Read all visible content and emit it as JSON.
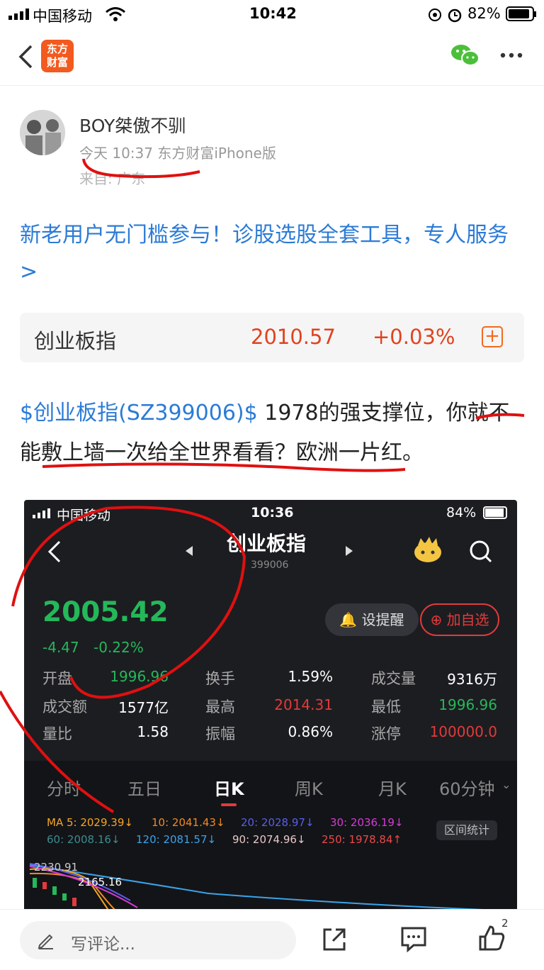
{
  "status_bar": {
    "carrier": "中国移动",
    "time": "10:42",
    "battery": "82%"
  },
  "nav": {
    "logo_top": "东方",
    "logo_bottom": "财富"
  },
  "author": {
    "name": "BOY桀傲不驯",
    "meta": "今天 10:37 东方财富iPhone版",
    "from": "来自: 广东"
  },
  "promo": "新老用户无门槛参与！诊股选股全套工具，专人服务>",
  "quote": {
    "name": "创业板指",
    "price": "2010.57",
    "change": "+0.03%",
    "add_icon": "+"
  },
  "post": {
    "tag": "$创业板指(SZ399006)$",
    "text": " 1978的强支撑位，你就不能敷上墙一次给全世界看看？欧洲一片红。"
  },
  "screenshot": {
    "status": {
      "carrier": "中国移动",
      "time": "10:36",
      "battery": "84%"
    },
    "title": "创业板指",
    "code": "399006",
    "price": "2005.42",
    "change": "-4.47",
    "change_pct": "-0.22%",
    "remind": "设提醒",
    "add": "加自选",
    "stats": [
      {
        "label": "开盘",
        "value": "1996.96",
        "color": "green"
      },
      {
        "label": "换手",
        "value": "1.59%",
        "color": "white"
      },
      {
        "label": "成交量",
        "value": "9316万",
        "color": "white"
      },
      {
        "label": "成交额",
        "value": "1577亿",
        "color": "white"
      },
      {
        "label": "最高",
        "value": "2014.31",
        "color": "red"
      },
      {
        "label": "最低",
        "value": "1996.96",
        "color": "green"
      },
      {
        "label": "量比",
        "value": "1.58",
        "color": "white"
      },
      {
        "label": "振幅",
        "value": "0.86%",
        "color": "white"
      },
      {
        "label": "涨停",
        "value": "100000.0",
        "color": "red"
      }
    ],
    "tabs": [
      "分时",
      "五日",
      "日K",
      "周K",
      "月K",
      "60分钟"
    ],
    "active_tab": "日K",
    "ma": [
      {
        "text": "MA 5: 2029.39↓",
        "color": "#f5a623"
      },
      {
        "text": "10: 2041.43↓",
        "color": "#f08a24"
      },
      {
        "text": "20: 2028.97↓",
        "color": "#5a5ee8"
      },
      {
        "text": "30: 2036.19↓",
        "color": "#d63bd6"
      },
      {
        "text": "60: 2008.16↓",
        "color": "#3a8d8d"
      },
      {
        "text": "120: 2081.57↓",
        "color": "#3aa3e8"
      },
      {
        "text": "90: 2074.96↓",
        "color": "#e8c7c7"
      },
      {
        "text": "250: 1978.84↑",
        "color": "#e84a4a"
      }
    ],
    "range_btn": "区间统计",
    "chart_high": "2230.91",
    "chart_label2": "2165.16"
  },
  "bottom": {
    "comment_placeholder": "写评论...",
    "like_count": "2"
  },
  "colors": {
    "accent_blue": "#2b7bd6",
    "accent_orange": "#f25a1f",
    "up_red": "#e1431f",
    "down_green": "#25b85a"
  }
}
